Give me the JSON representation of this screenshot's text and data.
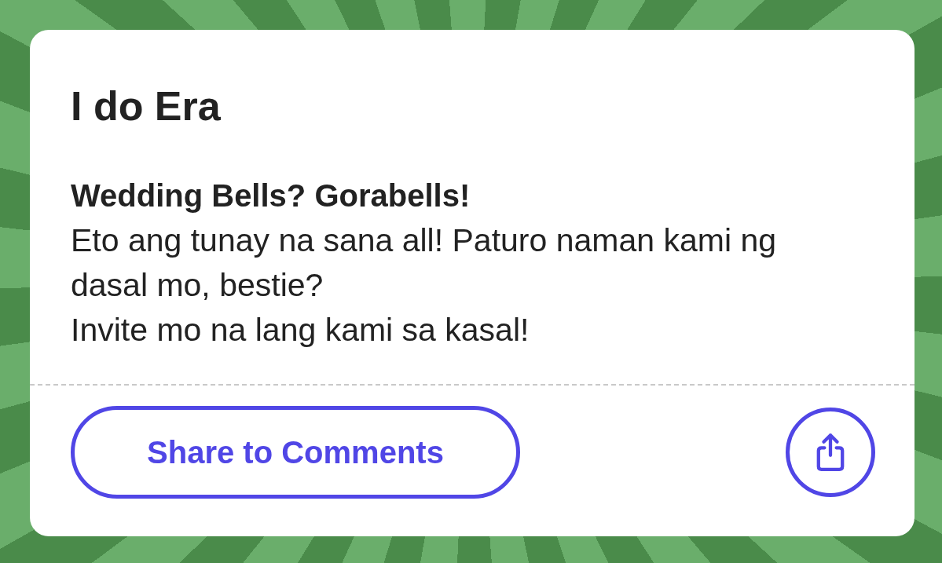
{
  "card": {
    "title": "I do Era",
    "subtitle": "Wedding Bells? Gorabells!",
    "paragraphs": [
      "Eto ang tunay na sana all! Paturo naman kami ng dasal mo, bestie?",
      "Invite mo na lang kami sa kasal!"
    ]
  },
  "actions": [
    {
      "kind": "pill",
      "label": "Share to Comments"
    },
    {
      "kind": "icon"
    }
  ]
}
